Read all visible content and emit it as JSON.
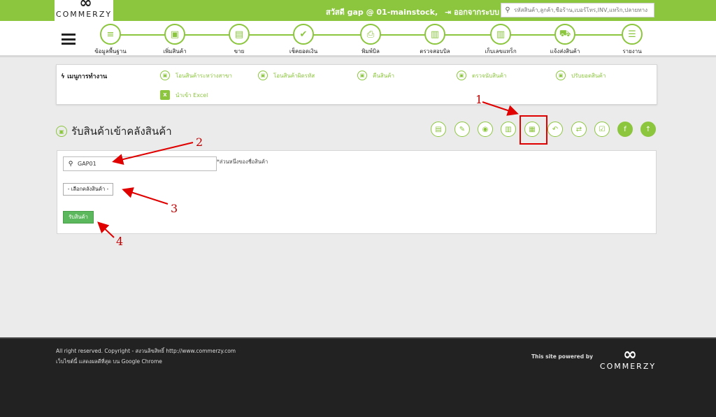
{
  "header": {
    "logo_mark": "∞",
    "logo_text": "COMMERZY",
    "greeting": "สวัสดี gap @ 01-mainstock,",
    "logout_icon": "logout-icon",
    "logout_label": "ออกจากระบบ",
    "search_placeholder": "รหัสสินค้า,ลูกค้า,ชื่อร้าน,เบอร์โทร,INV,แทร็ก,ปลายทาง",
    "search_icon": "search-icon"
  },
  "nav": {
    "items": [
      {
        "label": "ข้อมูลพื้นฐาน",
        "icon": "database-icon",
        "glyph": "≡"
      },
      {
        "label": "เพิ่มสินค้า",
        "icon": "box-icon",
        "glyph": "▣"
      },
      {
        "label": "ขาย",
        "icon": "cash-register-icon",
        "glyph": "▤"
      },
      {
        "label": "เช็คยอดเงิน",
        "icon": "money-check-icon",
        "glyph": "✔"
      },
      {
        "label": "พิมพ์บิล",
        "icon": "printer-icon",
        "glyph": "⎙"
      },
      {
        "label": "ตรวจสอบบิล",
        "icon": "barcode-scan-icon",
        "glyph": "▥"
      },
      {
        "label": "เก็บเลขแทร็ก",
        "icon": "tracking-scan-icon",
        "glyph": "▥"
      },
      {
        "label": "แจ้งส่งสินค้า",
        "icon": "truck-icon",
        "glyph": "⛟"
      },
      {
        "label": "รายงาน",
        "icon": "report-icon",
        "glyph": "☰"
      }
    ]
  },
  "menu": {
    "title": "เมนูการทำงาน",
    "title_icon": "bolt-icon",
    "links": [
      {
        "label": "โอนสินค้าระหว่างสาขา",
        "icon": "box-icon"
      },
      {
        "label": "โอนสินค้าผิดรหัส",
        "icon": "box-icon"
      },
      {
        "label": "คืนสินค้า",
        "icon": "box-icon"
      },
      {
        "label": "ตรวจนับสินค้า",
        "icon": "box-icon"
      },
      {
        "label": "ปรับยอดสินค้า",
        "icon": "box-icon"
      },
      {
        "label": "นำเข้า Excel",
        "icon": "excel-icon"
      }
    ]
  },
  "page": {
    "title": "รับสินค้าเข้าคลังสินค้า",
    "title_icon": "box-icon"
  },
  "toolbar": {
    "buttons": [
      {
        "icon": "document-icon",
        "glyph": "▤"
      },
      {
        "icon": "pencil-icon",
        "glyph": "✎"
      },
      {
        "icon": "camera-icon",
        "glyph": "◉"
      },
      {
        "icon": "barcode-icon",
        "glyph": "▥"
      },
      {
        "icon": "add-stock-icon",
        "glyph": "▦"
      },
      {
        "icon": "undo-icon",
        "glyph": "↶"
      },
      {
        "icon": "transfer-icon",
        "glyph": "⇄"
      },
      {
        "icon": "checklist-icon",
        "glyph": "☑"
      },
      {
        "icon": "facebook-icon",
        "glyph": "f"
      },
      {
        "icon": "arrow-up-icon",
        "glyph": "↑"
      }
    ]
  },
  "form": {
    "search_value": "GAP01",
    "search_icon": "search-icon",
    "hint": "*ส่วนหนึ่งของชื่อสินค้า",
    "select_value": "- เลือกคลังสินค้า -",
    "submit_label": "รับสินค้า"
  },
  "annotations": {
    "a1": "1",
    "a2": "2",
    "a3": "3",
    "a4": "4"
  },
  "footer": {
    "line1": "All right reserved. Copyright - สงวนลิขสิทธิ์ http://www.commerzy.com",
    "line2": "เว็บไซต์นี้ แสดงผลดีที่สุด บน Google Chrome",
    "powered": "This site powered by",
    "logo_mark": "∞",
    "logo_text": "COMMERZY"
  },
  "colors": {
    "accent": "#8cc63f",
    "annotation": "#c00000",
    "footer_bg": "#222222",
    "button_green": "#5cb85c"
  }
}
